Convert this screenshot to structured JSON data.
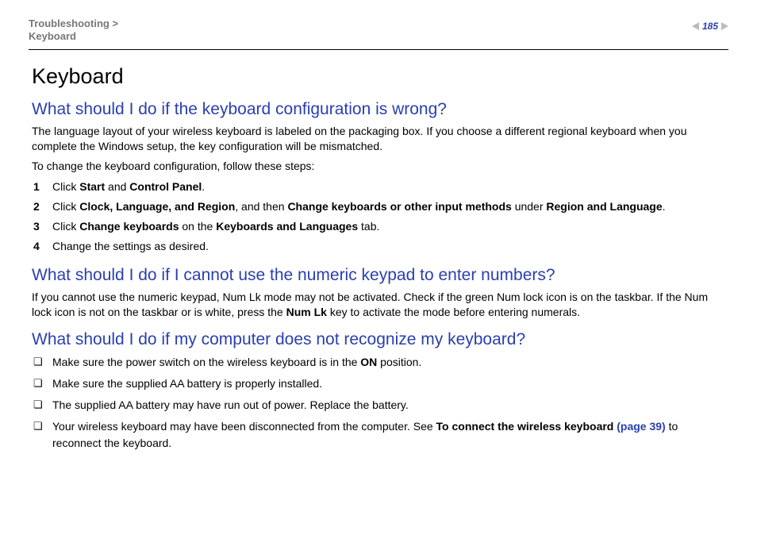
{
  "header": {
    "breadcrumb_line1": "Troubleshooting >",
    "breadcrumb_line2": "Keyboard",
    "page_number": "185"
  },
  "title": "Keyboard",
  "sections": [
    {
      "heading": "What should I do if the keyboard configuration is wrong?",
      "paras": [
        "The language layout of your wireless keyboard is labeled on the packaging box. If you choose a different regional keyboard when you complete the Windows setup, the key configuration will be mismatched.",
        "To change the keyboard configuration, follow these steps:"
      ],
      "steps": [
        {
          "n": "1",
          "pre": "Click ",
          "b1": "Start",
          "mid": " and ",
          "b2": "Control Panel",
          "post": "."
        },
        {
          "n": "2",
          "pre": "Click ",
          "b1": "Clock, Language, and Region",
          "mid": ", and then ",
          "b2": "Change keyboards or other input methods",
          "post2a": " under ",
          "b3": "Region and Language",
          "post": "."
        },
        {
          "n": "3",
          "pre": "Click ",
          "b1": "Change keyboards",
          "mid": " on the ",
          "b2": "Keyboards and Languages",
          "post": " tab."
        },
        {
          "n": "4",
          "pre": "Change the settings as desired."
        }
      ]
    },
    {
      "heading": "What should I do if I cannot use the numeric keypad to enter numbers?",
      "para_pre": "If you cannot use the numeric keypad, Num Lk mode may not be activated. Check if the green Num lock icon is on the taskbar. If the Num lock icon is not on the taskbar or is white, press the ",
      "para_b": "Num Lk",
      "para_post": " key to activate the mode before entering numerals."
    },
    {
      "heading": "What should I do if my computer does not recognize my keyboard?",
      "checks": [
        {
          "pre": "Make sure the power switch on the wireless keyboard is in the ",
          "b": "ON",
          "post": " position."
        },
        {
          "pre": "Make sure the supplied AA battery is properly installed."
        },
        {
          "pre": "The supplied AA battery may have run out of power. Replace the battery."
        },
        {
          "pre": "Your wireless keyboard may have been disconnected from the computer. See ",
          "b": "To connect the wireless keyboard",
          "link": " (page 39)",
          "post": " to reconnect the keyboard."
        }
      ]
    }
  ]
}
